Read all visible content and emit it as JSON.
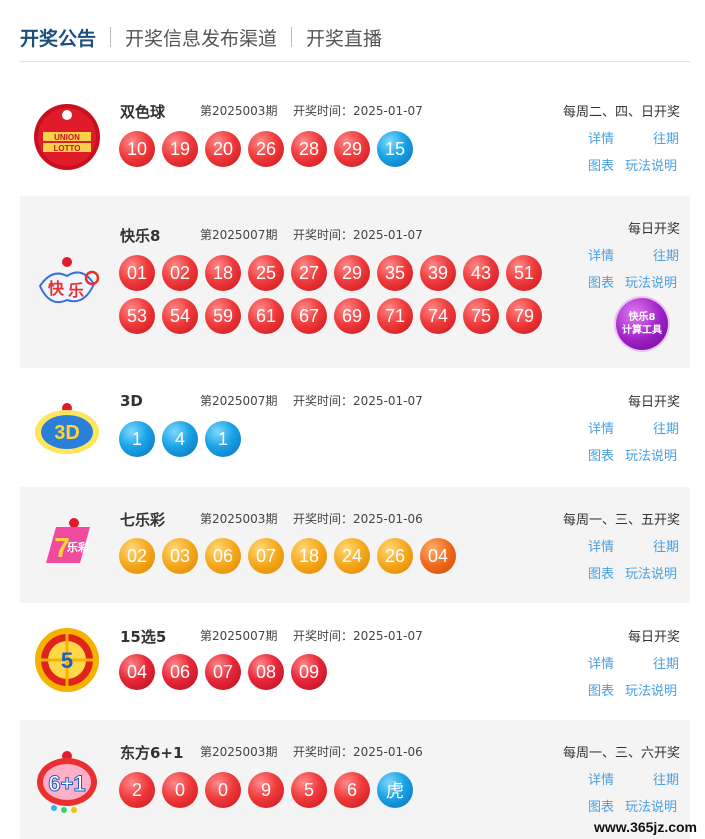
{
  "tabs": [
    {
      "label": "开奖公告"
    },
    {
      "label": "开奖信息发布渠道"
    },
    {
      "label": "开奖直播"
    }
  ],
  "common": {
    "details": "详情",
    "history": "往期",
    "chart": "图表",
    "rules": "玩法说明"
  },
  "lotteries": [
    {
      "name": "双色球",
      "issue": "第2025003期",
      "date": "开奖时间：2025-01-07",
      "schedule": "每周二、四、日开奖",
      "logo_text": "UNION LOTTO",
      "balls": [
        "10",
        "19",
        "20",
        "26",
        "28",
        "29",
        "15"
      ]
    },
    {
      "name": "快乐8",
      "issue": "第2025007期",
      "date": "开奖时间：2025-01-07",
      "schedule": "每日开奖",
      "balls": [
        "01",
        "02",
        "18",
        "25",
        "27",
        "29",
        "35",
        "39",
        "43",
        "51",
        "53",
        "54",
        "59",
        "61",
        "67",
        "69",
        "71",
        "74",
        "75",
        "79"
      ],
      "calc_line1": "快乐8",
      "calc_line2": "计算工具"
    },
    {
      "name": "3D",
      "issue": "第2025007期",
      "date": "开奖时间：2025-01-07",
      "schedule": "每日开奖",
      "balls": [
        "1",
        "4",
        "1"
      ]
    },
    {
      "name": "七乐彩",
      "issue": "第2025003期",
      "date": "开奖时间：2025-01-06",
      "schedule": "每周一、三、五开奖",
      "balls": [
        "02",
        "03",
        "06",
        "07",
        "18",
        "24",
        "26",
        "04"
      ]
    },
    {
      "name": "15选5",
      "issue": "第2025007期",
      "date": "开奖时间：2025-01-07",
      "schedule": "每日开奖",
      "balls": [
        "04",
        "06",
        "07",
        "08",
        "09"
      ]
    },
    {
      "name": "东方6+1",
      "issue": "第2025003期",
      "date": "开奖时间：2025-01-06",
      "schedule": "每周一、三、六开奖",
      "balls": [
        "2",
        "0",
        "0",
        "9",
        "5",
        "6",
        "虎"
      ]
    }
  ],
  "watermark": "www.365jz.com"
}
